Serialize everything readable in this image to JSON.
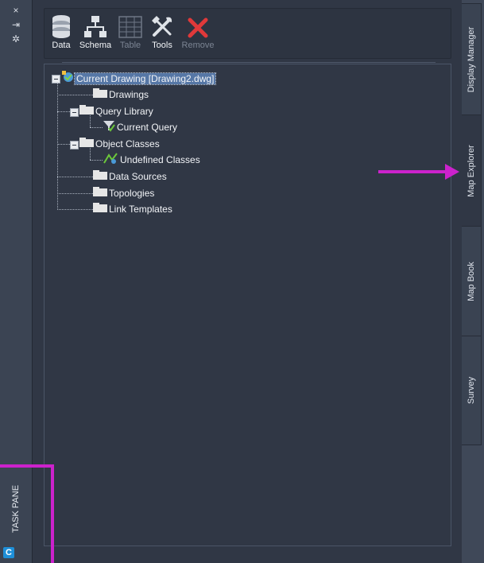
{
  "window": {
    "side_label": "TASK PANE",
    "logo_letter": "C",
    "side_buttons": [
      "×",
      "⇥",
      "✲"
    ]
  },
  "toolbar": {
    "buttons": [
      {
        "label": "Data",
        "enabled": true,
        "icon": "database-icon"
      },
      {
        "label": "Schema",
        "enabled": true,
        "icon": "schema-icon"
      },
      {
        "label": "Table",
        "enabled": false,
        "icon": "table-icon"
      },
      {
        "label": "Tools",
        "enabled": true,
        "icon": "tools-icon"
      },
      {
        "label": "Remove",
        "enabled": false,
        "icon": "remove-icon"
      }
    ]
  },
  "tree": {
    "root": {
      "label": "Current Drawing [Drawing2.dwg]",
      "selected": true
    },
    "items": [
      {
        "label": "Drawings"
      },
      {
        "label": "Query Library"
      },
      {
        "label": "Current Query"
      },
      {
        "label": "Object Classes"
      },
      {
        "label": "Undefined Classes"
      },
      {
        "label": "Data Sources"
      },
      {
        "label": "Topologies"
      },
      {
        "label": "Link Templates"
      }
    ]
  },
  "tabs": [
    {
      "label": "Display Manager",
      "active": false
    },
    {
      "label": "Map Explorer",
      "active": true
    },
    {
      "label": "Map Book",
      "active": false
    },
    {
      "label": "Survey",
      "active": false
    }
  ],
  "colors": {
    "panel_bg": "#303745",
    "strip_bg": "#3b4453",
    "selection": "#5677a6",
    "annotation": "#cc22cc"
  }
}
